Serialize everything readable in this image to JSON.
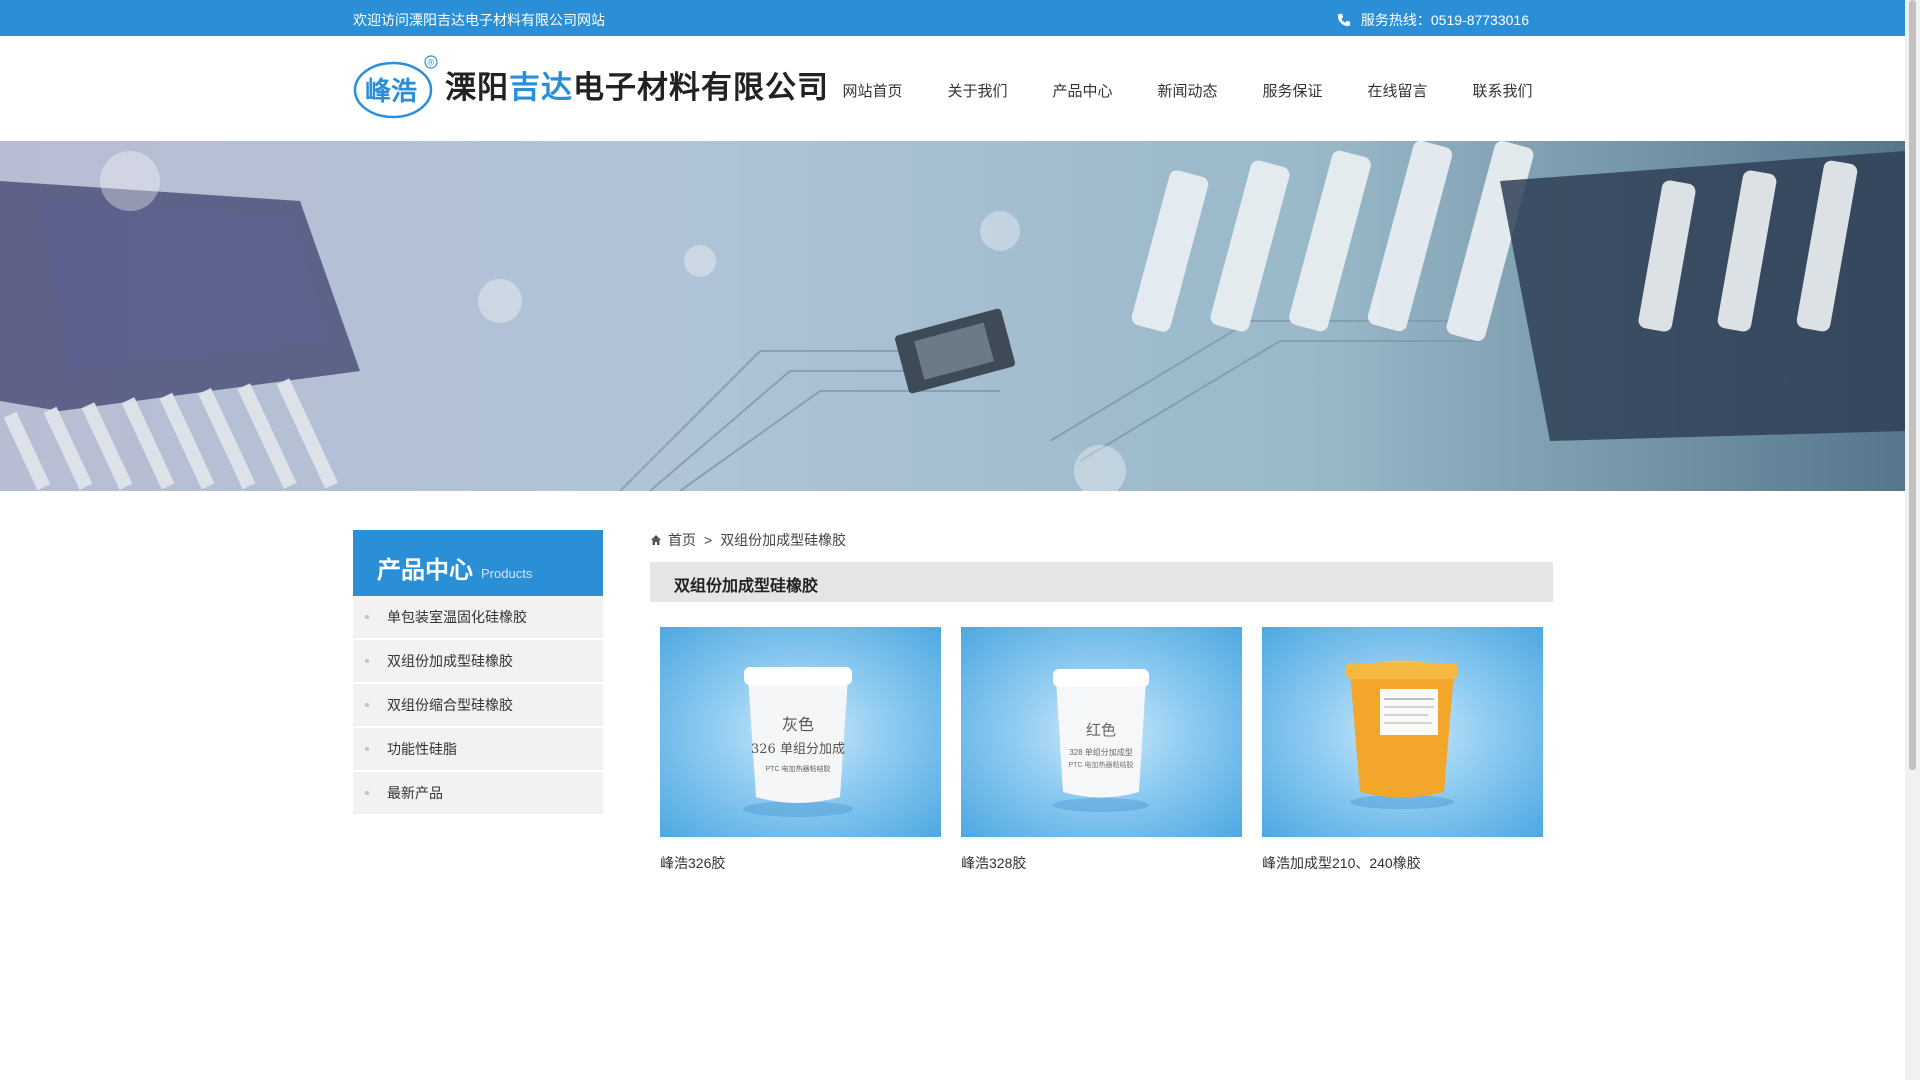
{
  "topbar": {
    "welcome": "欢迎访问溧阳吉达电子材料有限公司网站",
    "hotline_label": "服务热线：0519-87733016"
  },
  "header": {
    "logo_mark": "峰浩",
    "logo_text_1": "溧阳",
    "logo_text_2": "吉达",
    "logo_text_3": "电子材料有限公司",
    "registered": "®",
    "nav": [
      "网站首页",
      "关于我们",
      "产品中心",
      "新闻动态",
      "服务保证",
      "在线留言",
      "联系我们"
    ]
  },
  "sidebar": {
    "title_cn": "产品中心",
    "title_en": "Products",
    "items": [
      "单包装室温固化硅橡胶",
      "双组份加成型硅橡胶",
      "双组份缩合型硅橡胶",
      "功能性硅脂",
      "最新产品"
    ]
  },
  "main": {
    "breadcrumb_home": "首页",
    "breadcrumb_sep": ">",
    "breadcrumb_current": "双组份加成型硅橡胶",
    "category_title": "双组份加成型硅橡胶",
    "products": [
      {
        "name": "峰浩326胶",
        "label_line1": "灰色",
        "label_line2": "326 单组分加成",
        "label_line3": "PTC 电加热器粘结胶"
      },
      {
        "name": "峰浩328胶",
        "label_line1": "红色",
        "label_line2": "328 单组分加成型",
        "label_line3": "PTC 电加热器粘结胶"
      },
      {
        "name": "峰浩加成型210、240橡胶"
      }
    ]
  },
  "colors": {
    "accent": "#2b8fd8",
    "sidebar_bg": "#f2f2f2",
    "title_bar_bg": "#e5e5e5"
  }
}
